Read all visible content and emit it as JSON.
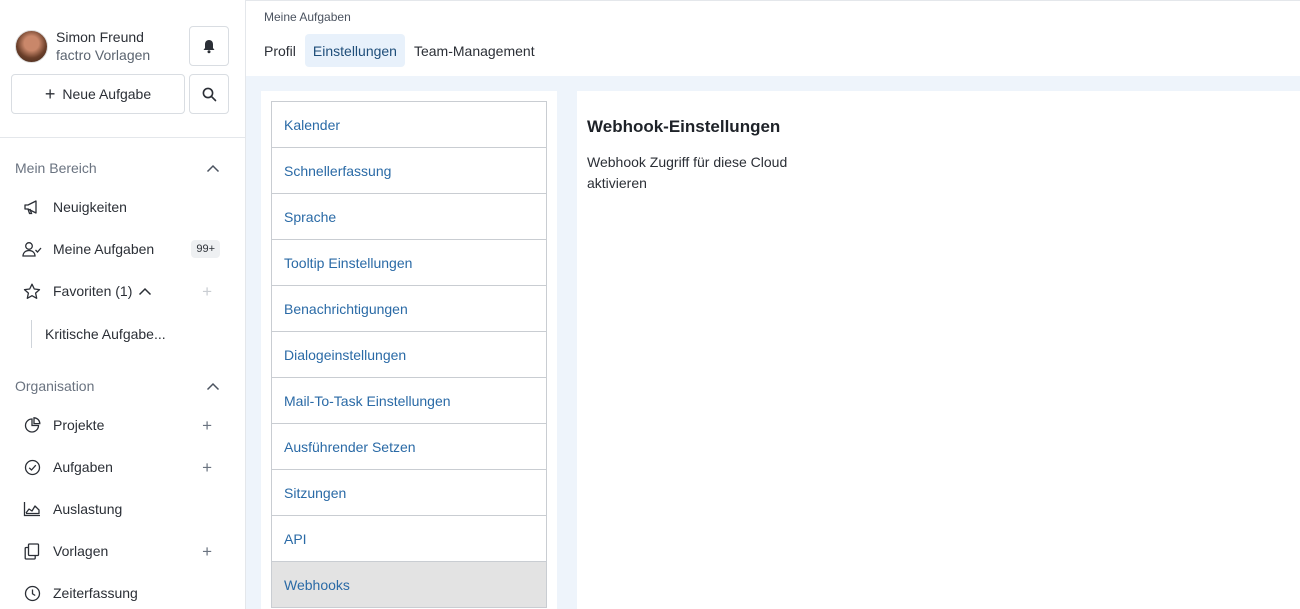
{
  "user": {
    "name": "Simon Freund",
    "org": "factro Vorlagen"
  },
  "sidebar": {
    "new_task_label": "Neue Aufgabe",
    "my_area": {
      "title": "Mein Bereich",
      "items": [
        {
          "label": "Neuigkeiten"
        },
        {
          "label": "Meine Aufgaben",
          "badge": "99+"
        },
        {
          "label": "Favoriten (1)"
        }
      ],
      "favorite_sub": "Kritische Aufgabe..."
    },
    "organisation": {
      "title": "Organisation",
      "items": [
        {
          "label": "Projekte"
        },
        {
          "label": "Aufgaben"
        },
        {
          "label": "Auslastung"
        },
        {
          "label": "Vorlagen"
        },
        {
          "label": "Zeiterfassung"
        }
      ]
    }
  },
  "header": {
    "breadcrumb": "Meine Aufgaben",
    "tabs": [
      {
        "label": "Profil"
      },
      {
        "label": "Einstellungen",
        "active": true
      },
      {
        "label": "Team-Management"
      }
    ]
  },
  "settings_menu": {
    "items": [
      {
        "label": "Kalender"
      },
      {
        "label": "Schnellerfassung"
      },
      {
        "label": "Sprache"
      },
      {
        "label": "Tooltip Einstellungen"
      },
      {
        "label": "Benachrichtigungen"
      },
      {
        "label": "Dialogeinstellungen"
      },
      {
        "label": "Mail-To-Task Einstellungen"
      },
      {
        "label": "Ausführender Setzen"
      },
      {
        "label": "Sitzungen"
      },
      {
        "label": "API"
      },
      {
        "label": "Webhooks",
        "active": true
      }
    ]
  },
  "detail": {
    "title": "Webhook-Einstellungen",
    "text": "Webhook Zugriff für diese Cloud aktivieren"
  },
  "colors": {
    "link": "#2a6aa6",
    "active_tab_bg": "#e8f1fb",
    "content_bg": "#eef4fb"
  }
}
